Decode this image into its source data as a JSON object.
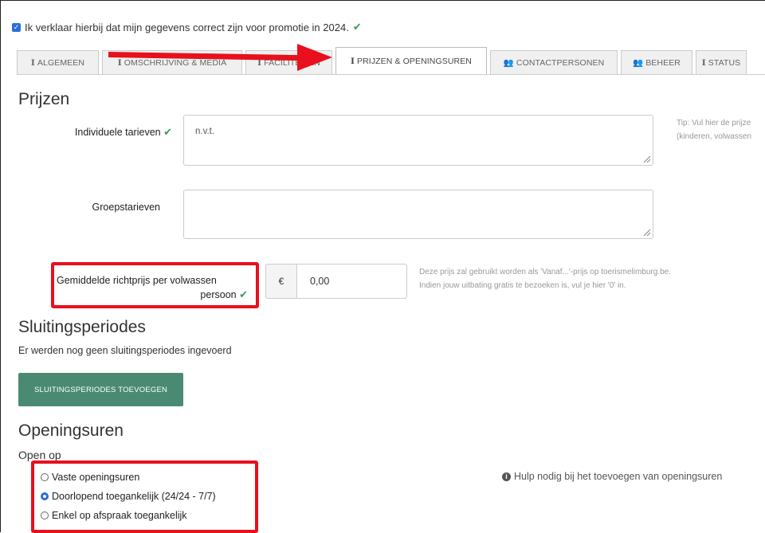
{
  "declaration": {
    "text": "Ik verklaar hierbij dat mijn gegevens correct zijn voor promotie in 2024."
  },
  "tabs": [
    {
      "label": "ALGEMEEN",
      "icon": "info-icon"
    },
    {
      "label": "OMSCHRIJVING & MEDIA",
      "icon": "info-icon"
    },
    {
      "label": "FACILITEITEN",
      "icon": "info-icon"
    },
    {
      "label": "PRIJZEN & OPENINGSUREN",
      "icon": "info-icon",
      "active": true
    },
    {
      "label": "CONTACTPERSONEN",
      "icon": "users-icon"
    },
    {
      "label": "BEHEER",
      "icon": "users-icon"
    },
    {
      "label": "STATUS",
      "icon": "info-icon"
    }
  ],
  "prijzen": {
    "heading": "Prijzen",
    "individuele_label": "Individuele tarieven",
    "individuele_value": "n.v.t.",
    "groeps_label": "Groepstarieven",
    "groeps_value": "",
    "tip_line1": "Tip: Vul hier de prijze",
    "tip_line2": "(kinderen, volwassen",
    "richtprijs_label_line1": "Gemiddelde richtprijs per volwassen",
    "richtprijs_label_line2": "persoon",
    "currency": "€",
    "richtprijs_value": "0,00",
    "richtprijs_help_line1": "Deze prijs zal gebruikt worden als 'Vanaf...'-prijs op toerismelimburg.be.",
    "richtprijs_help_line2": "Indien jouw uitbating gratis te bezoeken is, vul je hier '0' in."
  },
  "sluiting": {
    "heading": "Sluitingsperiodes",
    "empty_text": "Er werden nog geen sluitingsperiodes ingevoerd",
    "add_button": "SLUITINGSPERIODES TOEVOEGEN"
  },
  "openingsuren": {
    "heading": "Openingsuren",
    "open_op": "Open op",
    "options": [
      {
        "label": "Vaste openingsuren",
        "selected": false
      },
      {
        "label": "Doorlopend toegankelijk (24/24 - 7/7)",
        "selected": true
      },
      {
        "label": "Enkel op afspraak toegankelijk",
        "selected": false
      }
    ],
    "help_text": "Hulp nodig bij het toevoegen van openingsuren"
  },
  "colors": {
    "accent_red": "#e8101c",
    "button_green": "#4a8a73",
    "check_green": "#3a9a5c",
    "radio_blue": "#2a6fd6"
  }
}
